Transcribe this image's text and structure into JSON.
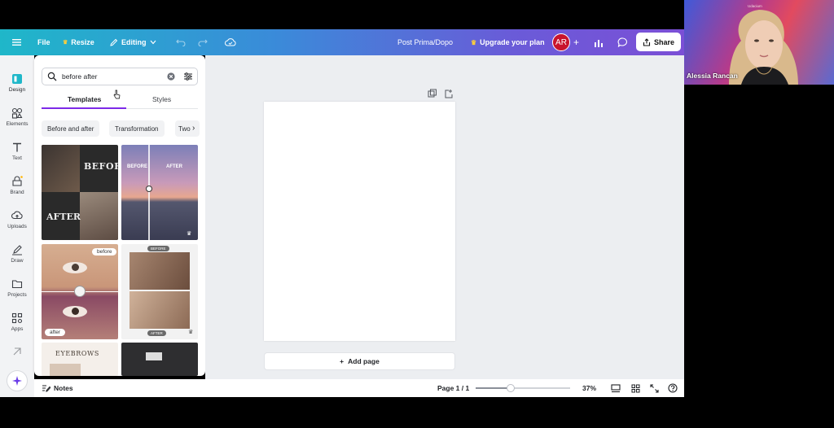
{
  "header": {
    "file_label": "File",
    "resize_label": "Resize",
    "editing_label": "Editing",
    "doc_title": "Post Prima/Dopo",
    "upgrade_label": "Upgrade your plan",
    "avatar_initials": "AR",
    "share_label": "Share",
    "gradient_colors": [
      "#1fb7c9",
      "#3a8bd9",
      "#7b4fd6"
    ]
  },
  "rail": {
    "items": [
      {
        "label": "Design",
        "icon": "design-icon"
      },
      {
        "label": "Elements",
        "icon": "elements-icon"
      },
      {
        "label": "Text",
        "icon": "text-icon"
      },
      {
        "label": "Brand",
        "icon": "brand-icon"
      },
      {
        "label": "Uploads",
        "icon": "uploads-icon"
      },
      {
        "label": "Draw",
        "icon": "draw-icon"
      },
      {
        "label": "Projects",
        "icon": "folder-icon"
      },
      {
        "label": "Apps",
        "icon": "apps-icon"
      }
    ]
  },
  "panel": {
    "search_value": "before after",
    "tabs": [
      "Templates",
      "Styles"
    ],
    "active_tab": "Templates",
    "chips": [
      "Before and after",
      "Transformation",
      "Two"
    ],
    "thumbs": [
      {
        "before_text": "BEFORE",
        "after_text": "AFTER"
      },
      {
        "before_text": "BEFORE",
        "after_text": "AFTER"
      },
      {
        "before_text": "before",
        "after_text": "after"
      },
      {
        "before_text": "BEFORE",
        "after_text": "AFTER"
      },
      {
        "title_text": "EYEBROWS"
      }
    ],
    "accent_color": "#7d2ae8"
  },
  "canvas": {
    "add_page_label": "Add page"
  },
  "bottom": {
    "notes_label": "Notes",
    "page_indicator": "Page 1 / 1",
    "zoom_label": "37%",
    "zoom_fraction": 0.37
  },
  "webcam": {
    "name": "Alessia Rancan",
    "top_caption": "Udacium"
  }
}
